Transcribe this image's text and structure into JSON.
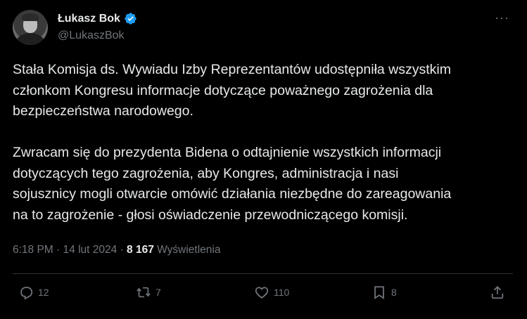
{
  "author": {
    "name": "Łukasz Bok",
    "handle": "@LukaszBok"
  },
  "more_label": "···",
  "tweet": {
    "text": "Stała Komisja ds. Wywiadu Izby Reprezentantów udostępniła wszystkim\nczłonkom Kongresu informacje dotyczące poważnego zagrożenia dla\nbezpieczeństwa narodowego.\n\nZwracam się do prezydenta Bidena o odtajnienie wszystkich informacji\ndotyczących tego zagrożenia, aby Kongres, administracja i nasi\nsojusznicy mogli otwarcie omówić działania niezbędne do zareagowania\nna to zagrożenie - głosi oświadczenie przewodniczącego komisji.",
    "time": "6:18 PM",
    "date": "14 lut 2024",
    "separator": "·",
    "views_count": "8 167",
    "views_label": "Wyświetlenia"
  },
  "actions": {
    "replies": "12",
    "reposts": "7",
    "likes": "110",
    "bookmarks": "8"
  },
  "colors": {
    "background": "#000000",
    "text": "#e7e9ea",
    "secondary": "#71767b",
    "verified": "#1d9bf0",
    "divider": "#2f3336"
  }
}
